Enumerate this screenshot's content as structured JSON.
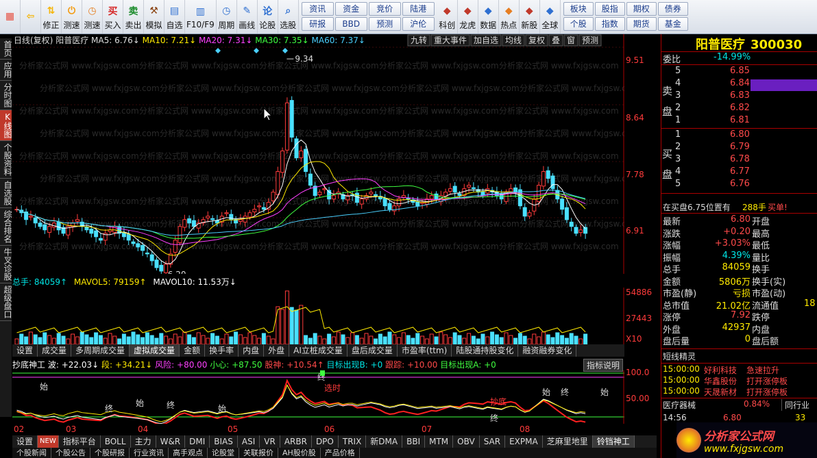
{
  "toolbar": {
    "items": [
      {
        "name": "home-button",
        "label": "",
        "icon": "grid"
      },
      {
        "name": "back-button",
        "label": "",
        "icon": "arrow-left"
      },
      {
        "name": "modify-button",
        "label": "修正",
        "icon": "updown"
      },
      {
        "name": "power-button",
        "label": "测速",
        "icon": "power"
      },
      {
        "name": "clock-button",
        "label": "测速",
        "icon": "clock"
      },
      {
        "name": "buy-button",
        "label": "买入",
        "icon": "买"
      },
      {
        "name": "sell-button",
        "label": "卖出",
        "icon": "卖"
      },
      {
        "name": "simulate-button",
        "label": "模拟",
        "icon": "hammer"
      },
      {
        "name": "watchlist-button",
        "label": "自选",
        "icon": "folder"
      },
      {
        "name": "f10-button",
        "label": "F10/F9",
        "icon": "doc"
      },
      {
        "name": "period-button",
        "label": "周期",
        "icon": "clock2"
      },
      {
        "name": "draw-button",
        "label": "画线",
        "icon": "pen"
      },
      {
        "name": "forum-button",
        "label": "论股",
        "icon": "论"
      },
      {
        "name": "select-stock-button",
        "label": "选股",
        "icon": "magnify"
      }
    ],
    "grid": [
      [
        "资讯",
        "资金",
        "竞价",
        "陆港"
      ],
      [
        "研报",
        "BBD",
        "预测",
        "沪伦"
      ]
    ],
    "items2": [
      {
        "name": "scientific-button",
        "label": "科创"
      },
      {
        "name": "dragon-tiger-button",
        "label": "龙虎"
      },
      {
        "name": "data-button",
        "label": "数据"
      },
      {
        "name": "hot-button",
        "label": "热点"
      },
      {
        "name": "new-stock-button",
        "label": "新股"
      },
      {
        "name": "global-button",
        "label": "全球"
      }
    ],
    "grid2": [
      [
        "板块",
        "股指",
        "期权",
        "债券"
      ],
      [
        "个股",
        "指数",
        "期货",
        "基金"
      ]
    ]
  },
  "leftnav": [
    "首页",
    "应用",
    "分时图",
    "K线图",
    "个股资料",
    "自选股",
    "综合排名",
    "牛叉诊股",
    "超级盘口"
  ],
  "chart_header": {
    "mode": "日线(复权)",
    "stock": "阳普医疗",
    "ma5": "MA5: 6.76↓",
    "ma10": "MA10: 7.21↓",
    "ma20": "MA20: 7.31↓",
    "ma30": "MA30: 7.35↓",
    "ma60": "MA60: 7.37↓"
  },
  "chart_buttons": [
    "九转",
    "重大事件",
    "加自选",
    "均线",
    "复权",
    "叠",
    "窗",
    "预测"
  ],
  "price_axis": [
    "9.51",
    "8.64",
    "7.78",
    "6.91"
  ],
  "high_label": "9.34",
  "low_label": "6.20",
  "marker": "财",
  "volume_header": {
    "total": "总手: 84059↑",
    "mavol5": "MAVOL5: 79159↑",
    "mavol10": "MAVOL10: 11.53万↓"
  },
  "volume_axis": [
    "54886",
    "27443",
    "X10"
  ],
  "tabs1": [
    "设置",
    "成交量",
    "多周期成交量",
    "虚拟成交量",
    "金额",
    "换手率",
    "内盘",
    "外盘",
    "AI立桩成交量",
    "盘后成交量",
    "市盈率(ttm)",
    "陆股通持股变化",
    "融资融券变化"
  ],
  "ind_header": {
    "name": "抄底神工",
    "wave": "波: +22.03↓",
    "seg": "段: +34.21↓",
    "risk": "风险: +80.00",
    "careful": "小心: +87.50",
    "god": "股神: +10.54↑",
    "target_b": "目标出现B: +0",
    "track": "跟踪: +10.00",
    "target_a": "目标出现A: +0",
    "explain": "指标说明"
  },
  "ind_axis": [
    "100.0",
    "50.00"
  ],
  "months": [
    "02",
    "03",
    "04",
    "05",
    "06",
    "07",
    "08"
  ],
  "ind_labels": [
    "始",
    "终",
    "始",
    "终",
    "始",
    "终",
    "选时",
    "抄底",
    "终",
    "始",
    "终",
    "始"
  ],
  "tabs2": [
    "设置",
    "NEW",
    "指标平台",
    "BOLL",
    "主力",
    "W&R",
    "DMI",
    "BIAS",
    "ASI",
    "VR",
    "ARBR",
    "DPO",
    "TRIX",
    "新DMA",
    "BBI",
    "MTM",
    "OBV",
    "SAR",
    "EXPMA",
    "芝麻里地里",
    "铃铛神工"
  ],
  "tabs3": [
    "个股新闻",
    "个股公告",
    "个股研报",
    "行业资讯",
    "高手观点",
    "论股堂",
    "关联报价",
    "AH股价股",
    "产品价格"
  ],
  "quote": {
    "title": "阳普医疗",
    "code": "300030",
    "weibi_label": "委比",
    "weibi": "-14.99%",
    "sell_label": "卖盘",
    "buy_label": "买盘",
    "sell": [
      [
        "5",
        "6.85"
      ],
      [
        "4",
        "6.84"
      ],
      [
        "3",
        "6.83"
      ],
      [
        "2",
        "6.82"
      ],
      [
        "1",
        "6.81"
      ]
    ],
    "buy": [
      [
        "1",
        "6.80"
      ],
      [
        "2",
        "6.79"
      ],
      [
        "3",
        "6.78"
      ],
      [
        "4",
        "6.77"
      ],
      [
        "5",
        "6.76"
      ]
    ],
    "inbuy": "在买盘6.75位置有",
    "inbuy_qty": "288手",
    "inbuy_tag": "买单!",
    "stats": [
      [
        "最新",
        "6.80",
        "开盘",
        ""
      ],
      [
        "涨跌",
        "+0.20",
        "最高",
        ""
      ],
      [
        "涨幅",
        "+3.03%",
        "最低",
        ""
      ],
      [
        "振幅",
        "4.39%",
        "量比",
        ""
      ],
      [
        "总手",
        "84059",
        "换手",
        ""
      ],
      [
        "金额",
        "5806万",
        "换手(实)",
        ""
      ],
      [
        "市盈(静)",
        "亏损",
        "市盈(动)",
        ""
      ],
      [
        "总市值",
        "21.02亿",
        "流通值",
        "18"
      ],
      [
        "涨停",
        "7.92",
        "跌停",
        ""
      ],
      [
        "外盘",
        "42937",
        "内盘",
        ""
      ],
      [
        "盘后量",
        "0",
        "盘后额",
        ""
      ]
    ],
    "short_title": "短线精灵",
    "short": [
      [
        "15:00:00",
        "好利科技",
        "急速拉升"
      ],
      [
        "15:00:00",
        "华鑫股份",
        "打开涨停板"
      ],
      [
        "15:00:00",
        "天晟新材",
        "打开涨停板"
      ]
    ],
    "sector": "医疗器械",
    "sector_pct": "0.84%",
    "sector_rank": "同行业",
    "last_time": "14:56",
    "last_price": "6.80",
    "last_vol": "33"
  },
  "watermark": "分析家公式网 www.fxjgsw.com",
  "brand": "分析家公式网",
  "brand_url": "www.fxjgsw.com"
}
